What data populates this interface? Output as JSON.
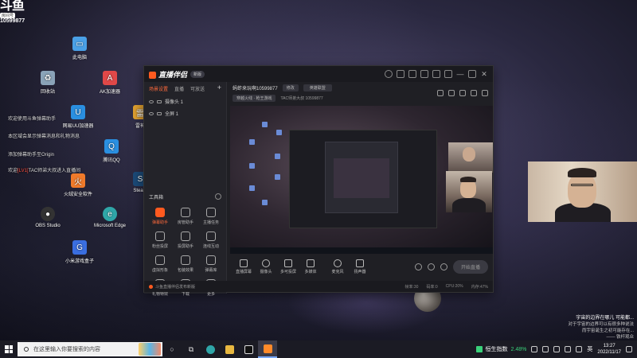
{
  "overlay": {
    "brand_logo": "斗鱼",
    "brand_sub": "房间号",
    "room_id": "10599877"
  },
  "danmu": [
    {
      "text": "欢迎使用斗鱼弹幕助手"
    },
    {
      "text": "本区域会显示弹幕消息和礼物消息"
    },
    {
      "text": "添加弹幕助手至Origin"
    },
    {
      "prefix": "欢迎",
      "highlight": "[LV1]",
      "suffix": "TAC师弟大叔进入直播间"
    }
  ],
  "desktop_icons": [
    {
      "label": "此电脑",
      "icon": "computer-icon",
      "color": "#4aa0e6"
    },
    {
      "label": "回收站",
      "icon": "recycle-bin-icon",
      "color": "#8aa3b8"
    },
    {
      "label": "AK加速器",
      "icon": "ak-accelerator-icon",
      "color": "#e04848"
    },
    {
      "label": "雷神",
      "icon": "leishen-icon",
      "color": "#e0a030"
    },
    {
      "label": "网易UU加速器",
      "icon": "uu-accelerator-icon",
      "color": "#2a8fe0"
    },
    {
      "label": "腾讯QQ",
      "icon": "qq-icon",
      "color": "#2a8fe0"
    },
    {
      "label": "Steam",
      "icon": "steam-icon",
      "color": "#1b4a78"
    },
    {
      "label": "火绒安全软件",
      "icon": "huorong-icon",
      "color": "#f07a2a"
    },
    {
      "label": "OBS Studio",
      "icon": "obs-icon",
      "color": "#333"
    },
    {
      "label": "Microsoft Edge",
      "icon": "edge-icon",
      "color": "#2fa6a8"
    },
    {
      "label": "小米游戏盒子",
      "icon": "xiaomi-game-box-icon",
      "color": "#3a6ee0"
    }
  ],
  "app": {
    "title": "直播伴侣",
    "version": "新版",
    "sidebar_tabs": [
      "场景设置",
      "直播",
      "可放送"
    ],
    "scenes": [
      "摄像头 1",
      "全屏 1"
    ],
    "tools_title": "工具箱",
    "tools": [
      "弹幕助手",
      "房管助手",
      "主播任务",
      "粉丝投屏",
      "投屏助手",
      "连线互动",
      "虚拟形象",
      "包装效果",
      "弹幕库",
      "礼物特效",
      "下载",
      "更多"
    ],
    "streamer_name": "蚂蚱来玩啊10599877",
    "edit_pill": "修改",
    "category": "英雄联盟",
    "tag_label": "穿越火线 · 枪王游戏",
    "meta_text": "TAC师弟大叔 10599877",
    "controls": [
      "直播屏幕",
      "摄像头",
      "多可投屏",
      "多媒体",
      "麦克风",
      "扬声器"
    ],
    "go_live": "开始直播",
    "status_msg": "斗鱼直播伴侣发布新版",
    "status_stats": [
      "帧率:30",
      "码率:0",
      "CPU:20%",
      "内存:47%"
    ]
  },
  "chat": {
    "line1": "宇宙的边界在哪儿 可能都...",
    "line2": "对于宇宙的边界可以有很多种说法",
    "line3": "而宇宙诞生之初可能存在...",
    "author": "—— 铁杆观众"
  },
  "taskbar": {
    "search_placeholder": "在这里输入你要搜索的内容",
    "stock_name": "恒生指数",
    "stock_change": "2.48%",
    "ime": "英",
    "time": "13:27",
    "date": "2022/11/17"
  }
}
